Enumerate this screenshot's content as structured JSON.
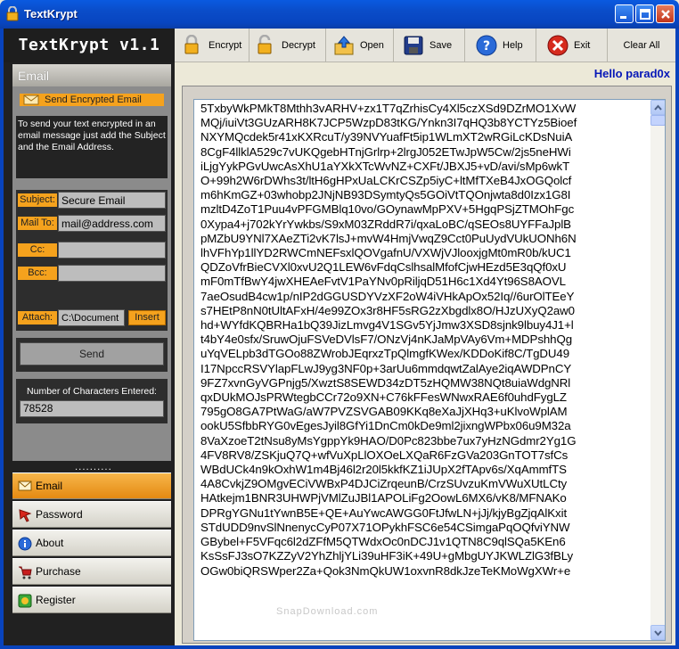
{
  "window": {
    "title": "TextKrypt"
  },
  "sidebar": {
    "logo": "TextKrypt v1.1",
    "section_title": "Email",
    "send_encrypted": "Send Encrypted Email",
    "info": "To send your text encrypted in an email message just add the Subject and the Email Address.",
    "subject_label": "Subject:",
    "subject_value": "Secure Email",
    "mailto_label": "Mail To:",
    "mailto_value": "mail@address.com",
    "cc_label": "Cc:",
    "cc_value": "",
    "bcc_label": "Bcc:",
    "bcc_value": "",
    "attach_label": "Attach:",
    "attach_value": "C:\\Document",
    "insert_label": "Insert",
    "send_label": "Send",
    "count_label": "Number of Characters Entered:",
    "count_value": "78528",
    "grip": "..........",
    "nav": [
      {
        "label": "Email",
        "icon": "envelope-icon",
        "active": true
      },
      {
        "label": "Password",
        "icon": "pointer-icon"
      },
      {
        "label": "About",
        "icon": "info-icon"
      },
      {
        "label": "Purchase",
        "icon": "cart-icon"
      },
      {
        "label": "Register",
        "icon": "register-icon"
      }
    ]
  },
  "toolbar": {
    "encrypt": "Encrypt",
    "decrypt": "Decrypt",
    "open": "Open",
    "save": "Save",
    "help": "Help",
    "exit": "Exit",
    "clear_all": "Clear All"
  },
  "greeting": "Hello parad0x",
  "encrypted_text": [
    "5TxbyWkPMkT8Mthh3vARHV+zx1T7qZrhisCy4Xl5czXSd9DZrMO1XvW",
    "MQj/iuiVt3GUzARH8K7JCP5WzpD83tKG/Ynkn3I7qHQ3b8YCTYz5Bioef",
    "NXYMQcdek5r41xKXRcuT/y39NVYuafFt5ip1WLmXT2wRGiLcKDsNuiA",
    "8CgF4llklA529c7vUKQgebHTnjGrlrp+2lrgJ052ETwJpW5Cw/2js5neHWi",
    "iLjgYykPGvUwcAsXhU1aYXkXTcWvNZ+CXFt/JBXJ5+vD/avi/sMp6wkT",
    "O+99h2W6rDWhs3t/ltH6gHPxUaLCKrCSZp5iyC+ltMfTXeB4JxOGQolcf",
    "m6hKmGZ+03whobp2JNjNB93DSymtyQs5GOiVtTQOnjwta8d0Izx1G8I",
    "mzltD4ZoT1Puu4vPFGMBlq10vo/GOynawMpPXV+5HgqPSjZTMOhFgc",
    "0Xypa4+j702kYrYwkbs/S9xM03ZRddR7i/qxaLoBC/qSEOs8UYFFaJplB",
    "pMZbU9YNl7XAeZTi2vK7lsJ+mvW4HmjVwqZ9Cct0PuUydVUkUONh6N",
    "lhVFhYp1llYD2RWCmNEFsxlQOVgafnU/VXWjVJlooxjgMt0mR0b/kUC1",
    "QDZoVfrBieCVXl0xvU2Q1LEW6vFdqCslhsalMfofCjwHEzd5E3qQf0xU",
    "mF0mTfBwY4jwXHEAeFvtV1PaYNv0pRiljqD51H6c1Xd4Yt96S8AOVL",
    "7aeOsudB4cw1p/nIP2dGGUSDYVzXF2oW4iVHkApOx52Iq//6urOlTEeY",
    "s7HEtP8nN0tUltAFxH/4e99ZOx3r8HF5sRG2zXbgdlx8O/HJzUXyQ2aw0",
    "hd+WYfdKQBRHa1bQ39JizLmvg4V1SGv5YjJmw3XSD8sjnk9lbuy4J1+l",
    "t4bY4e0sfx/SruwOjuFSVeDVlsF7/ONzVj4nKJaMpVAy6Vm+MDPshhQg",
    "uYqVELpb3dTGOo88ZWrobJEqrxzTpQlmgfKWex/KDDoKif8C/TgDU49",
    "I17NpccRSVYlapFLwJ9yg3NF0p+3arUu6mmdqwtZalAye2iqAWDPnCY",
    "9FZ7xvnGyVGPnjg5/XwztS8SEWD34zDT5zHQMW38NQt8uiaWdgNRl",
    "qxDUkMOJsPRWtegbCCr72o9XN+C76kFFesWNwxRAE6f0uhdFygLZ",
    "795gO8GA7PtWaG/aW7PVZSVGAB09KKq8eXaJjXHq3+uKlvoWplAM",
    "ookU5SfbbRYG0vEgesJyil8GfYi1DnCm0kDe9ml2jixngWPbx06u9M32a",
    "8VaXzoeT2tNsu8yMsYgppYk9HAO/D0Pc823bbe7ux7yHzNGdmr2Yg1G",
    "4FV8RV8/ZSKjuQ7Q+wfVuXpLlOXOeLXQaR6FzGVa203GnTOT7sfCs",
    "WBdUCk4n9kOxhW1m4Bj46l2r20l5kkfKZ1iJUpX2fTApv6s/XqAmmfTS",
    "4A8CvkjZ9OMgvECiVWBxP4DJCiZrqeunB/CrzSUvzuKmVWuXUtLCty",
    "HAtkejm1BNR3UHWPjVMlZuJBl1APOLiFg2OowL6MX6/vK8/MFNAKo",
    "DPRgYGNu1tYwnB5E+QE+AuYwcAWGG0FtJfwLN+jJj/kjyBgZjqAlKxit",
    "STdUDD9nvSlNnenycCyP07X71OPykhFSC6e54CSimgaPqOQfviYNW",
    "GBybel+F5VFqc6l2dZFfM5QTWdxOc0nDCJ1v1QTN8C9qlSQa5KEn6",
    "KsSsFJ3sO7KZZyV2YhZhljYLi39uHF3iK+49U+gMbgUYJKWLZlG3fBLy",
    "OGw0biQRSWper2Za+Qok3NmQkUW1oxvnR8dkJzeTeKMoWgXWr+e"
  ],
  "watermark": "SnapDownload.com"
}
